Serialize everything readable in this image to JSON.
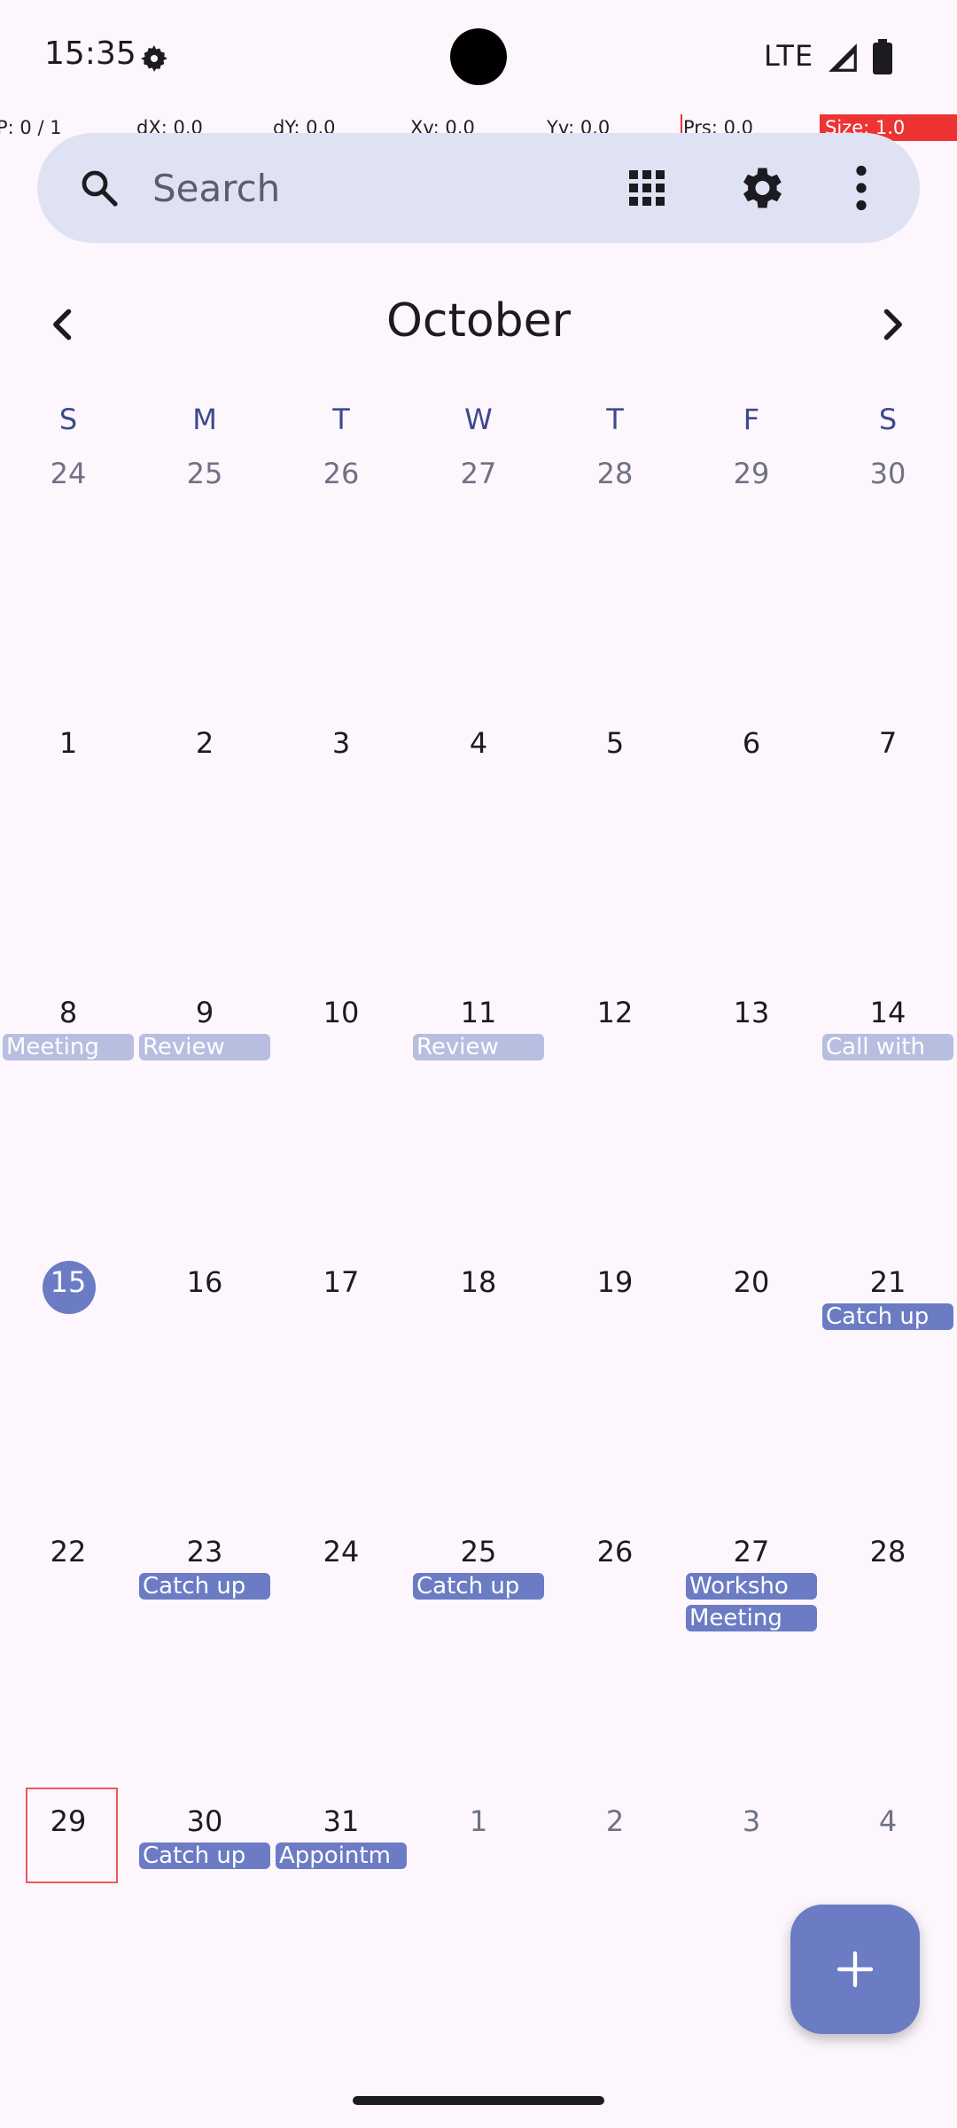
{
  "status_bar": {
    "time": "15:35",
    "network": "LTE"
  },
  "debug": {
    "p": "P: 0 / 1",
    "dx": "dX: 0.0",
    "dy": "dY: 0.0",
    "xv": "Xv: 0.0",
    "yv": "Yv: 0.0",
    "prs": "Prs: 0.0",
    "size": "Size: 1.0"
  },
  "search": {
    "placeholder": "Search"
  },
  "month": {
    "title": "October"
  },
  "weekdays": [
    "S",
    "M",
    "T",
    "W",
    "T",
    "F",
    "S"
  ],
  "weeks": [
    {
      "days": [
        "24",
        "25",
        "26",
        "27",
        "28",
        "29",
        "30"
      ]
    },
    {
      "days": [
        "1",
        "2",
        "3",
        "4",
        "5",
        "6",
        "7"
      ]
    },
    {
      "days": [
        "8",
        "9",
        "10",
        "11",
        "12",
        "13",
        "14"
      ]
    },
    {
      "days": [
        "15",
        "16",
        "17",
        "18",
        "19",
        "20",
        "21"
      ]
    },
    {
      "days": [
        "22",
        "23",
        "24",
        "25",
        "26",
        "27",
        "28"
      ]
    },
    {
      "days": [
        "29",
        "30",
        "31",
        "1",
        "2",
        "3",
        "4"
      ]
    }
  ],
  "events": {
    "w3_sun": "Meeting",
    "w3_mon": "Review",
    "w3_wed": "Review",
    "w3_sat": "Call with",
    "w4_sat": "Catch up",
    "w5_mon": "Catch up",
    "w5_wed": "Catch up",
    "w5_fri_1": "Worksho",
    "w5_fri_2": "Meeting",
    "w6_mon": "Catch up",
    "w6_tue": "Appointm"
  },
  "colors": {
    "accent": "#6b7bc4",
    "accent_light": "#b8bee0",
    "surface": "#fdf7fd",
    "search_bg": "#dfe2f3",
    "selected_outline": "#e85a5a"
  }
}
